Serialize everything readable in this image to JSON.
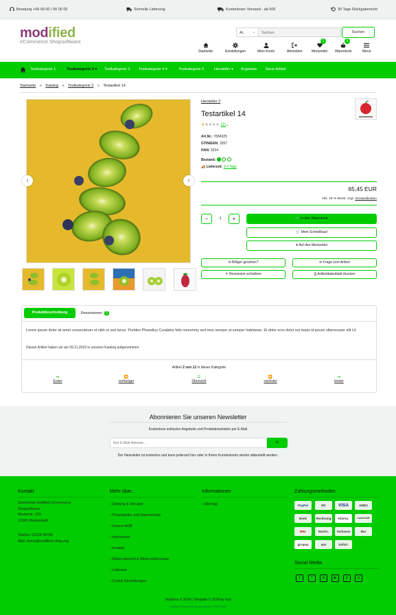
{
  "topbar": {
    "items": [
      {
        "label": "Beratung +49 00 00 / 00 00 00",
        "icon": "headset-icon"
      },
      {
        "label": "Schnelle Lieferung",
        "icon": "truck-fast-icon"
      },
      {
        "label": "Kostenloser Versand - ab 50€",
        "icon": "truck-icon"
      },
      {
        "label": "30 Tage Rückgaberecht",
        "icon": "return-icon"
      }
    ]
  },
  "logo": {
    "main_a": "mod",
    "main_b": "ified",
    "sub": "eCommerce Shopsoftware"
  },
  "search": {
    "select": "Al..",
    "placeholder": "Suchen",
    "button": "Suchen"
  },
  "header_icons": [
    {
      "label": "Startseite",
      "icon": "home-icon"
    },
    {
      "label": "Einstellungen",
      "icon": "gear-icon"
    },
    {
      "label": "Mein Konto",
      "icon": "user-icon"
    },
    {
      "label": "Abmelden",
      "icon": "logout-icon"
    },
    {
      "label": "Merkzettel",
      "icon": "heart-icon",
      "badge": "1"
    },
    {
      "label": "Warenkorb",
      "icon": "basket-icon",
      "badge": "3"
    },
    {
      "label": "Menü",
      "icon": "menu-icon"
    }
  ],
  "nav": {
    "items": [
      "Testkategorie 1",
      "Testkategorie 2 ▾",
      "Testkategorie 3",
      "Testkategorie 4 ▾",
      "Testkategorie 5",
      "Hersteller ▾",
      "Angebote",
      "Neue Artikel"
    ]
  },
  "breadcrumb": {
    "items": [
      "Startseite",
      "Katalog",
      "Testkategorie 2"
    ],
    "current": "Testartikel 14"
  },
  "product": {
    "manufacturer": "Hersteller 2",
    "title": "Testartikel 14",
    "rating_count": "(1)",
    "rating": 4,
    "art_nr_label": "Art.Nr.:",
    "art_nr": "7834325",
    "gtin_label": "GTIN/EAN:",
    "gtin": "3357",
    "han_label": "HAN:",
    "han": "3224",
    "stock_label": "Bestand:",
    "delivery_label": "Lieferzeit:",
    "delivery": "3-4 Tage",
    "price": "65,45 EUR",
    "tax_text": "inkl. 19 % MwSt. zzgl.",
    "shipping_link": "Versandkosten",
    "qty": "1",
    "cart_btn": "In den Warenkorb",
    "quickbuy_btn": "Mein Schnellkauf",
    "wishlist_btn": "Auf den Merkzettel",
    "cheaper_btn": "Billiger gesehen?",
    "question_btn": "Frage zum Artikel",
    "review_btn": "Rezension schreiben",
    "print_btn": "Artikeldatenblatt drucken"
  },
  "tabs": {
    "active": "Produktbeschreibung",
    "reviews": "Rezensionen",
    "reviews_count": "1",
    "description": "Lorem ipsum dolor sit amet consectetuer et nibh et sed lacus. Porttitor Phasellus Curabitur felis nonummy sed mus semper at semper habitasse. Et dolor eros dolor est turpis id ipsum ullamcorper elit Ut.",
    "added": "Diesen Artikel haben wir am 09.11.2023 in unseren Katalog aufgenommen."
  },
  "pager": {
    "pre": "Artikel",
    "current": "2 von 12",
    "post": "in dieser Kategorie",
    "links": [
      {
        "label": "Erster",
        "icon": "first-icon"
      },
      {
        "label": "vorheriger",
        "icon": "prev-icon"
      },
      {
        "label": "Übersicht",
        "icon": "list-icon"
      },
      {
        "label": "nächster",
        "icon": "next-icon"
      },
      {
        "label": "letzter",
        "icon": "last-icon"
      }
    ]
  },
  "newsletter": {
    "title": "Abonnieren Sie unseren Newsletter",
    "subtitle": "Kostenlose exklusive Angebote und Produktneuheiten per E-Mail",
    "placeholder": "Ihre E-Mail-Adresse ...",
    "note": "Der Newsletter ist kostenlos und kann jederzeit hier oder in Ihrem Kundenkonto wieder abbestellt werden."
  },
  "footer": {
    "contact_title": "Kontakt",
    "contact_lines": [
      "Demoshop modified eCommerce",
      "Shopsoftware",
      "Musterstr. 123",
      "12345 Musterstadt"
    ],
    "phone": "Telefon: 01234 56789",
    "mail": "Mail: demo@modified-shop.org",
    "more_title": "Mehr über...",
    "more_links": [
      "Zahlung & Versand",
      "Privatsphäre und Datenschutz",
      "Unsere AGB",
      "Impressum",
      "Kontakt",
      "Widerrufsrecht & Widerrufsformular",
      "Lieferzeit",
      "Cookie Einstellungen"
    ],
    "info_title": "Informationen",
    "info_links": [
      "Sitemap"
    ],
    "pay_title": "Zahlungsmethoden",
    "pay": [
      "PayPal",
      "MC",
      "VISA",
      "AMEX",
      "Bank",
      "Rechnung",
      "Klarna.",
      "Lastschrift",
      "DHL",
      "Nachn.",
      "Vorkasse",
      "Bar",
      "giropay",
      "eps",
      "Sofort."
    ],
    "social_title": "Social Media",
    "social": [
      "f",
      "t",
      "in",
      "▶",
      "p",
      "◎"
    ],
    "copyright": "Testfirma © 2024 | Template © 2024 by Karl",
    "small": "modified eCommerce Shopsoftware © 2009-2024"
  },
  "colors": {
    "accent": "#00cc00",
    "logo_purple": "#8a3b7a",
    "logo_green": "#7fb03f"
  }
}
